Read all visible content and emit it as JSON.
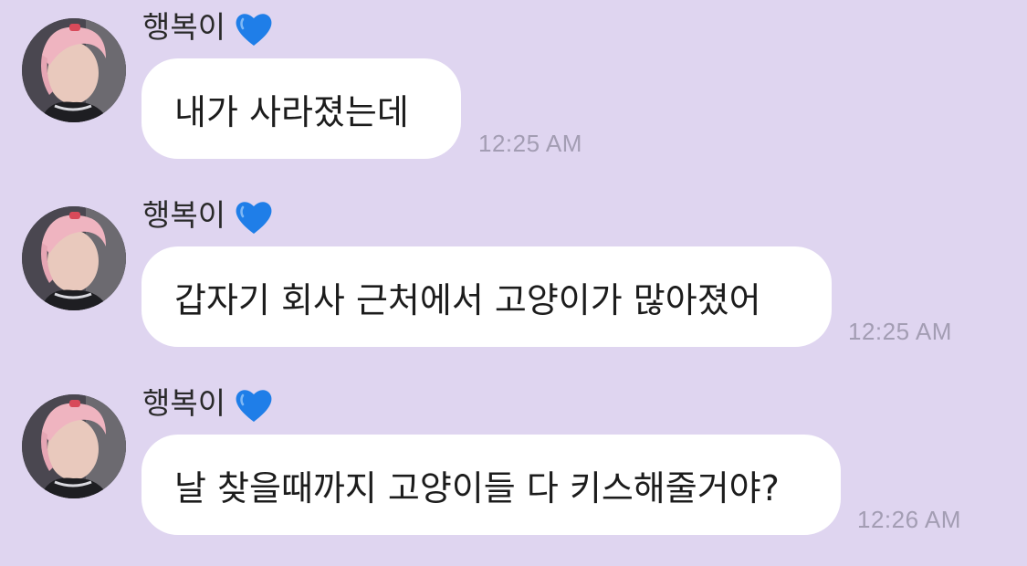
{
  "chat": {
    "background": "#dfd5f0",
    "messages": [
      {
        "sender": "행복이",
        "sender_badge": "blue-heart-icon",
        "text": "내가 사라졌는데",
        "time": "12:25 AM"
      },
      {
        "sender": "행복이",
        "sender_badge": "blue-heart-icon",
        "text": "갑자기 회사 근처에서 고양이가 많아졌어",
        "time": "12:25 AM"
      },
      {
        "sender": "행복이",
        "sender_badge": "blue-heart-icon",
        "text": "날 찾을때까지 고양이들 다 키스해줄거야?",
        "time": "12:26 AM"
      }
    ]
  }
}
